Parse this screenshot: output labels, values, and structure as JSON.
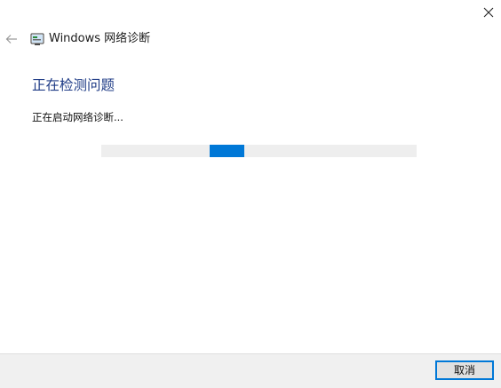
{
  "window": {
    "title": "Windows 网络诊断",
    "close_icon": "close-icon",
    "back_icon": "back-arrow-icon",
    "app_icon": "network-diagnostics-icon"
  },
  "content": {
    "heading": "正在检测问题",
    "status": "正在启动网络诊断..."
  },
  "progress": {
    "mode": "indeterminate"
  },
  "footer": {
    "cancel_label": "取消"
  },
  "colors": {
    "heading": "#1e3b86",
    "accent": "#0078d7",
    "progress_track": "#eeeeee",
    "footer_bg": "#f0f0f0"
  }
}
